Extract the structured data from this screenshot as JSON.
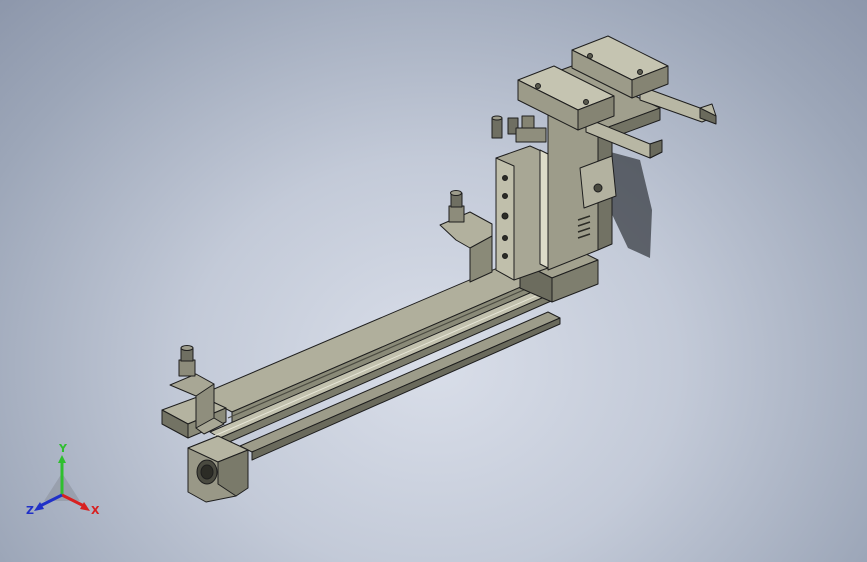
{
  "viewport": {
    "model": "linear-slide-pick-and-place-assembly",
    "view_style": "shaded-with-edges",
    "background_top": "#8d97ab",
    "background_center": "#d9dee9"
  },
  "triad": {
    "y_label": "Y",
    "x_label": "X",
    "z_label": "Z",
    "y_color": "#2fbf2f",
    "x_color": "#d82020",
    "z_color": "#2030c8"
  },
  "colors": {
    "metal_light": "#a3a28f",
    "metal_mid": "#8a8a78",
    "metal_dark": "#5c5c50",
    "edge": "#1e1e1e",
    "shadow": "#3a3d44"
  }
}
